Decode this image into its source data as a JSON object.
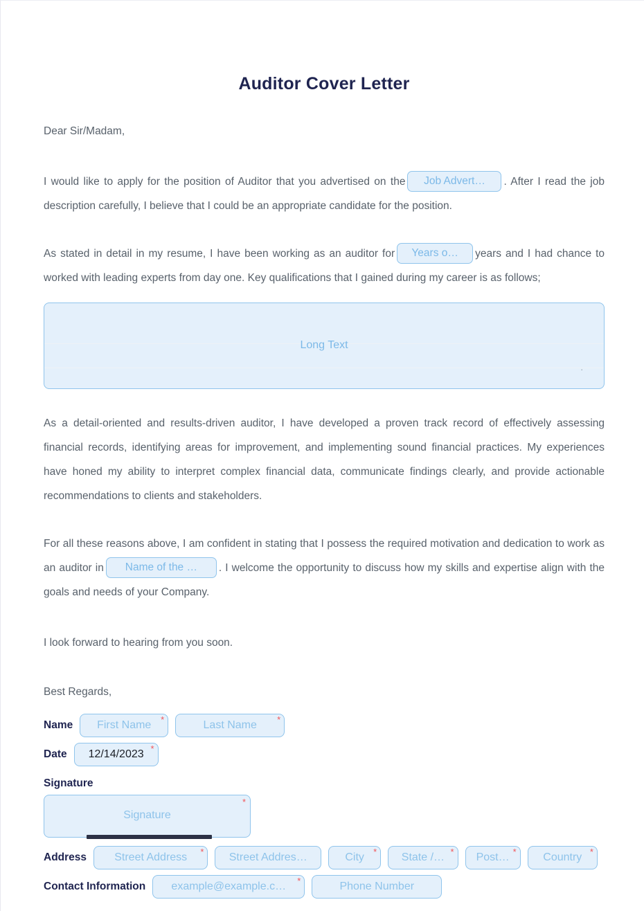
{
  "document": {
    "title": "Auditor Cover Letter",
    "salutation": "Dear Sir/Madam,",
    "paragraph_1_before": "I would like to apply for the position of Auditor that you advertised on the",
    "paragraph_1_after": ". After I read the job description carefully, I believe that I could be an appropriate candidate for the position.",
    "paragraph_2_before": "As stated in detail in my resume, I have been working as an auditor for",
    "paragraph_2_after": "years and I had chance to worked with leading experts from day one. Key qualifications that I gained during my career is as follows;",
    "paragraph_3": "As a detail-oriented and results-driven auditor, I have developed a proven track record of effectively assessing financial records, identifying areas for improvement, and implementing sound financial practices. My experiences have honed my ability to interpret complex financial data, communicate findings clearly, and provide actionable recommendations to clients and stakeholders.",
    "paragraph_4_before": "For all these reasons above, I am confident in stating that I possess the required motivation and dedication to work as an auditor in",
    "paragraph_4_after": ". I welcome the opportunity to discuss how my skills and expertise align with the goals and needs of your Company.",
    "paragraph_5": "I look forward to hearing from you soon.",
    "closing": "Best Regards,"
  },
  "inline_fields": {
    "job_advert": {
      "placeholder": "Job Advert…"
    },
    "years_of_experience": {
      "placeholder": "Years o…"
    },
    "company_name": {
      "placeholder": "Name of the …"
    }
  },
  "long_text": {
    "placeholder": "Long Text",
    "value": "",
    "resize_dot": "."
  },
  "form": {
    "required_marker": "*",
    "name": {
      "label": "Name",
      "first": {
        "placeholder": "First Name",
        "value": "",
        "required": true
      },
      "last": {
        "placeholder": "Last Name",
        "value": "",
        "required": true
      }
    },
    "date": {
      "label": "Date",
      "field": {
        "placeholder": "",
        "value": "12/14/2023",
        "required": true
      }
    },
    "signature": {
      "label": "Signature",
      "field": {
        "placeholder": "Signature",
        "value": "",
        "required": true
      }
    },
    "address": {
      "label": "Address",
      "street1": {
        "placeholder": "Street Address",
        "value": "",
        "required": true
      },
      "street2": {
        "placeholder": "Street Addres…",
        "value": "",
        "required": false
      },
      "city": {
        "placeholder": "City",
        "value": "",
        "required": true
      },
      "state": {
        "placeholder": "State /…",
        "value": "",
        "required": true
      },
      "postal": {
        "placeholder": "Post…",
        "value": "",
        "required": true
      },
      "country": {
        "placeholder": "Country",
        "value": "",
        "required": true
      }
    },
    "contact": {
      "label": "Contact Information",
      "email": {
        "placeholder": "example@example.c…",
        "value": "",
        "required": true
      },
      "phone": {
        "placeholder": "Phone Number",
        "value": "",
        "required": false
      }
    }
  },
  "colors": {
    "title": "#1f2450",
    "body_text": "#58616b",
    "field_fill": "#e4f0fb",
    "field_border": "#8fc4ec",
    "placeholder": "#7cb9e8",
    "required_asterisk": "#f2565a",
    "signature_line": "#2c3145",
    "page_background": "#ffffff"
  }
}
